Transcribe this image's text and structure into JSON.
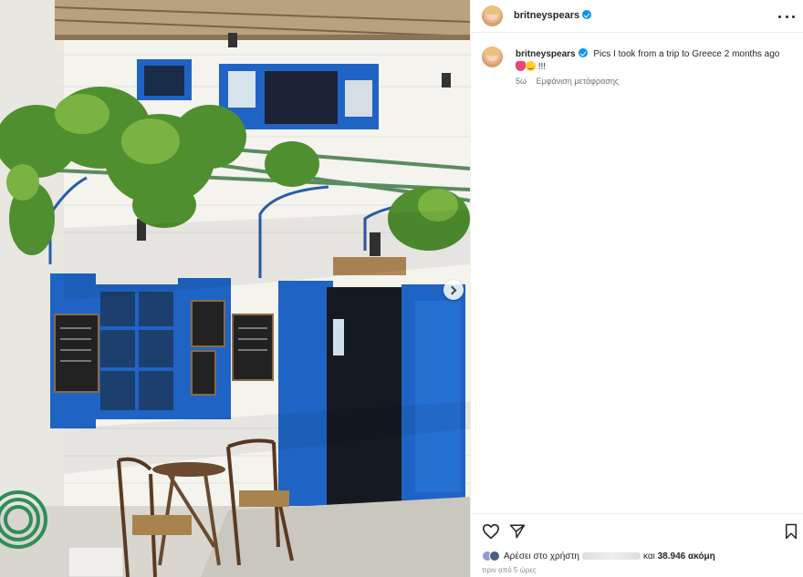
{
  "post": {
    "username": "britneyspears",
    "verified": true,
    "caption": "Pics I took from a trip to Greece 2 months ago",
    "caption_suffix": "!!!",
    "caption_emojis": [
      "tulip",
      "smiling-face"
    ],
    "caption_age": "5ω",
    "see_translation": "Εμφάνιση μετάφρασης",
    "likes_prefix": "Αρέσει στο χρήστη",
    "likes_joiner": "και",
    "likes_count": "38.946",
    "likes_suffix": "ακόμη",
    "timestamp": "πριν από 5 ώρες"
  },
  "photo": {
    "description_icon": "greek-taverna-photo",
    "carousel_icon": "chevron-right-icon"
  },
  "colors": {
    "accent_blue": "#0095f6",
    "shutter_blue": "#1f64c4",
    "text_primary": "#262626",
    "text_secondary": "#737373"
  },
  "icons": {
    "header_more": "more-horizontal-icon",
    "like": "heart-icon",
    "share": "send-icon",
    "save": "bookmark-icon"
  }
}
